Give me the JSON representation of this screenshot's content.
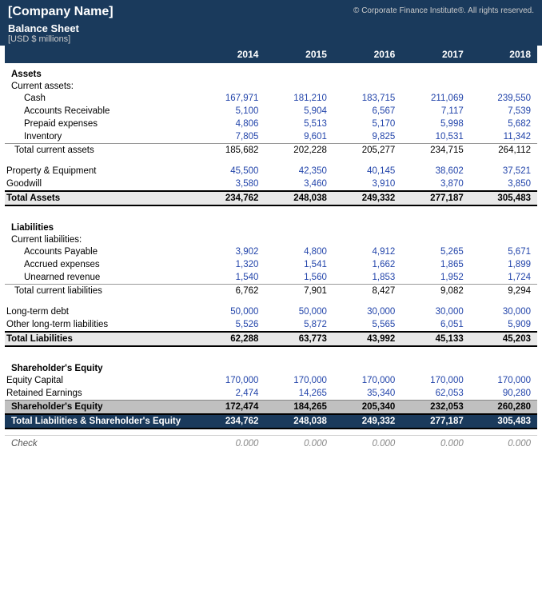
{
  "header": {
    "company_name": "[Company Name]",
    "copyright": "© Corporate Finance Institute®. All rights reserved."
  },
  "sheet_title": "Balance Sheet",
  "currency_note": "[USD $ millions]",
  "columns": {
    "years": [
      "2014",
      "2015",
      "2016",
      "2017",
      "2018"
    ]
  },
  "sections": {
    "assets_label": "Assets",
    "current_assets_label": "Current assets:",
    "cash_label": "Cash",
    "cash": [
      "167,971",
      "181,210",
      "183,715",
      "211,069",
      "239,550"
    ],
    "ar_label": "Accounts Receivable",
    "ar": [
      "5,100",
      "5,904",
      "6,567",
      "7,117",
      "7,539"
    ],
    "prepaid_label": "Prepaid expenses",
    "prepaid": [
      "4,806",
      "5,513",
      "5,170",
      "5,998",
      "5,682"
    ],
    "inventory_label": "Inventory",
    "inventory": [
      "7,805",
      "9,601",
      "9,825",
      "10,531",
      "11,342"
    ],
    "total_current_assets_label": "Total current assets",
    "total_current_assets": [
      "185,682",
      "202,228",
      "205,277",
      "234,715",
      "264,112"
    ],
    "ppe_label": "Property & Equipment",
    "ppe": [
      "45,500",
      "42,350",
      "40,145",
      "38,602",
      "37,521"
    ],
    "goodwill_label": "Goodwill",
    "goodwill": [
      "3,580",
      "3,460",
      "3,910",
      "3,870",
      "3,850"
    ],
    "total_assets_label": "Total Assets",
    "total_assets": [
      "234,762",
      "248,038",
      "249,332",
      "277,187",
      "305,483"
    ],
    "liabilities_label": "Liabilities",
    "current_liabilities_label": "Current liabilities:",
    "ap_label": "Accounts Payable",
    "ap": [
      "3,902",
      "4,800",
      "4,912",
      "5,265",
      "5,671"
    ],
    "accrued_label": "Accrued expenses",
    "accrued": [
      "1,320",
      "1,541",
      "1,662",
      "1,865",
      "1,899"
    ],
    "unearned_label": "Unearned revenue",
    "unearned": [
      "1,540",
      "1,560",
      "1,853",
      "1,952",
      "1,724"
    ],
    "total_current_liabilities_label": "Total current liabilities",
    "total_current_liabilities": [
      "6,762",
      "7,901",
      "8,427",
      "9,082",
      "9,294"
    ],
    "ltd_label": "Long-term debt",
    "ltd": [
      "50,000",
      "50,000",
      "30,000",
      "30,000",
      "30,000"
    ],
    "other_lt_label": "Other long-term liabilities",
    "other_lt": [
      "5,526",
      "5,872",
      "5,565",
      "6,051",
      "5,909"
    ],
    "total_liabilities_label": "Total Liabilities",
    "total_liabilities": [
      "62,288",
      "63,773",
      "43,992",
      "45,133",
      "45,203"
    ],
    "equity_label": "Shareholder's Equity",
    "equity_capital_label": "Equity Capital",
    "equity_capital": [
      "170,000",
      "170,000",
      "170,000",
      "170,000",
      "170,000"
    ],
    "retained_label": "Retained Earnings",
    "retained": [
      "2,474",
      "14,265",
      "35,340",
      "62,053",
      "90,280"
    ],
    "total_equity_label": "Shareholder's Equity",
    "total_equity": [
      "172,474",
      "184,265",
      "205,340",
      "232,053",
      "260,280"
    ],
    "total_liab_equity_label": "Total Liabilities & Shareholder's Equity",
    "total_liab_equity": [
      "234,762",
      "248,038",
      "249,332",
      "277,187",
      "305,483"
    ],
    "check_label": "Check",
    "check": [
      "0.000",
      "0.000",
      "0.000",
      "0.000",
      "0.000"
    ]
  }
}
